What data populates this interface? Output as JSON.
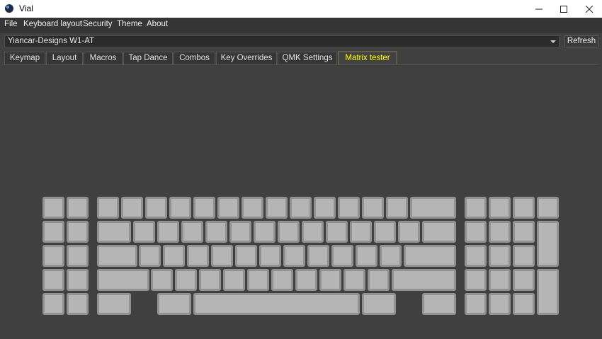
{
  "window": {
    "title": "Vial"
  },
  "menu": [
    "File",
    "Keyboard layout",
    "Security",
    "Theme",
    "About"
  ],
  "device": {
    "selected": "Yiancar-Designs W1-AT",
    "refresh_label": "Refresh"
  },
  "tabs": [
    "Keymap",
    "Layout",
    "Macros",
    "Tap Dance",
    "Combos",
    "Key Overrides",
    "QMK Settings",
    "Matrix tester"
  ],
  "active_tab": "Matrix tester",
  "colors": {
    "key_face": "#b5b5b5",
    "key_border": "#929292",
    "background": "#404040",
    "active_tab_text": "#ffff00"
  },
  "icons": {
    "app": "vial-logo-icon",
    "minimize": "minimize-icon",
    "maximize": "maximize-icon",
    "close": "close-icon",
    "dropdown": "chevron-down-icon"
  }
}
